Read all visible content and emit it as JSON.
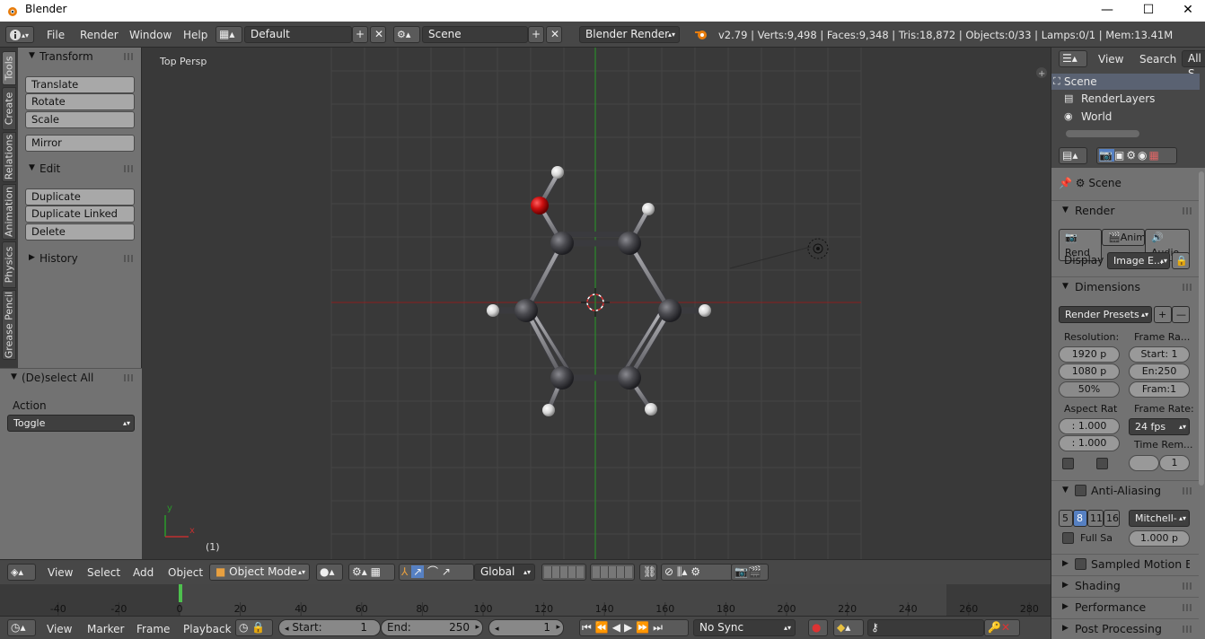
{
  "window": {
    "title": "Blender",
    "minimize": "—",
    "maximize": "☐",
    "close": "✕"
  },
  "menu": {
    "file": "File",
    "render": "Render",
    "window": "Window",
    "help": "Help"
  },
  "screen_layout": "Default",
  "scene_name": "Scene",
  "render_engine": "Blender Render",
  "stats": "v2.79 | Verts:9,498 | Faces:9,348 | Tris:18,872 | Objects:0/33 | Lamps:0/1 | Mem:13.41M",
  "tabs": [
    "Tools",
    "Create",
    "Relations",
    "Animation",
    "Physics",
    "Grease Pencil"
  ],
  "toolshelf": {
    "transform_header": "Transform",
    "translate": "Translate",
    "rotate": "Rotate",
    "scale": "Scale",
    "mirror": "Mirror",
    "edit_header": "Edit",
    "duplicate": "Duplicate",
    "duplicate_linked": "Duplicate Linked",
    "delete": "Delete",
    "history_header": "History"
  },
  "redo": {
    "header": "(De)select All",
    "action_label": "Action",
    "action_value": "Toggle"
  },
  "viewport": {
    "view_name": "Top Persp",
    "frame": "(1)",
    "axis_y": "y",
    "axis_x": "x"
  },
  "v3d_header": {
    "view": "View",
    "select": "Select",
    "add": "Add",
    "object": "Object",
    "mode": "Object Mode",
    "orientation": "Global"
  },
  "timeline": {
    "ticks": [
      "-40",
      "-20",
      "0",
      "20",
      "40",
      "60",
      "80",
      "100",
      "120",
      "140",
      "160",
      "180",
      "200",
      "220",
      "240",
      "260",
      "280"
    ],
    "current_frame": 1
  },
  "tl_header": {
    "view": "View",
    "marker": "Marker",
    "frame": "Frame",
    "playback": "Playback",
    "start_label": "Start:",
    "start": "1",
    "end_label": "End:",
    "end": "250",
    "current": "1",
    "sync": "No Sync"
  },
  "outliner": {
    "view": "View",
    "search": "Search",
    "all": "All S",
    "items": [
      "Scene",
      "RenderLayers",
      "World"
    ]
  },
  "properties": {
    "scene": "Scene",
    "render_header": "Render",
    "render_btn": "Rend",
    "anim_btn": "Anima",
    "audio_btn": "Audio",
    "display_label": "Display",
    "display_value": "Image E...",
    "dimensions_header": "Dimensions",
    "presets": "Render Presets",
    "resolution_label": "Resolution:",
    "res_x": "1920 p",
    "res_y": "1080 p",
    "res_pct": "50%",
    "frame_range_label": "Frame Ra...",
    "start": "Start: 1",
    "end": "En:250",
    "frame": "Fram:1",
    "aspect_label": "Aspect Rat",
    "aspect_x": ": 1.000",
    "aspect_y": ": 1.000",
    "frame_rate_label": "Frame Rate:",
    "fps": "24 fps",
    "time_remap_label": "Time Rem...",
    "time_remap_value": "1",
    "aa_header": "Anti-Aliasing",
    "aa_samples": [
      "5",
      "8",
      "11",
      "16"
    ],
    "aa_filter": "Mitchell-",
    "full_sample": "Full Sa",
    "filter_size": "1.000 p",
    "smb_header": "Sampled Motion Blur",
    "shading_header": "Shading",
    "performance_header": "Performance",
    "postproc_header": "Post Processing"
  },
  "colors": {
    "oxygen": "#cc1010",
    "carbon": "#4a4a4f",
    "hydrogen": "#e6e6e6",
    "x_axis": "#8a2020",
    "y_axis": "#2a8a2a",
    "aa_selected": "#5680c2"
  }
}
